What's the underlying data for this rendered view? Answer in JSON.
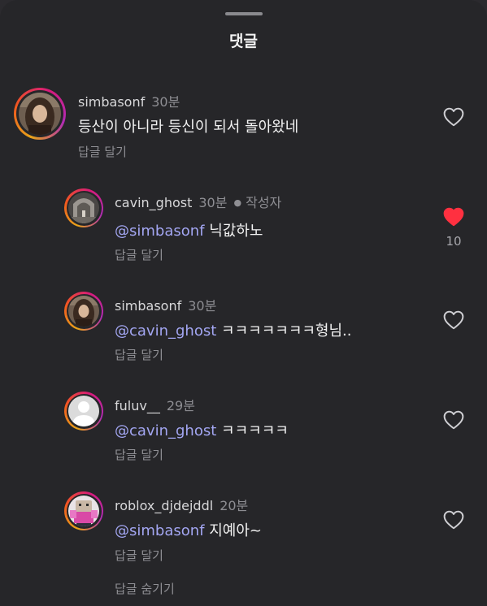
{
  "header": {
    "title": "댓글"
  },
  "comments": [
    {
      "username": "simbasonf",
      "time": "30분",
      "mention": "",
      "text": "등산이 아니라 등신이 되서 돌아왔네",
      "reply_label": "답글 달기",
      "liked": false
    },
    {
      "username": "cavin_ghost",
      "time": "30분",
      "author_badge": "작성자",
      "mention": "@simbasonf",
      "text": "닉값하노",
      "reply_label": "답글 달기",
      "liked": true,
      "like_count": "10"
    },
    {
      "username": "simbasonf",
      "time": "30분",
      "mention": "@cavin_ghost",
      "text": "ㅋㅋㅋㅋㅋㅋㅋ형님..",
      "reply_label": "답글 달기",
      "liked": false
    },
    {
      "username": "fuluv__",
      "time": "29분",
      "mention": "@cavin_ghost",
      "text": "ㅋㅋㅋㅋㅋ",
      "reply_label": "답글 달기",
      "liked": false
    },
    {
      "username": "roblox_djdejddl",
      "time": "20분",
      "mention": "@simbasonf",
      "text": "지예아~",
      "reply_label": "답글 달기",
      "liked": false
    }
  ],
  "hide_replies_label": "답글 숨기기",
  "icons": {
    "heart": "heart-icon",
    "heart_filled": "heart-filled-icon",
    "default_avatar": "default-avatar-icon"
  },
  "colors": {
    "background": "#262629",
    "mention": "#a3a6f2",
    "liked_heart": "#ff3040"
  }
}
